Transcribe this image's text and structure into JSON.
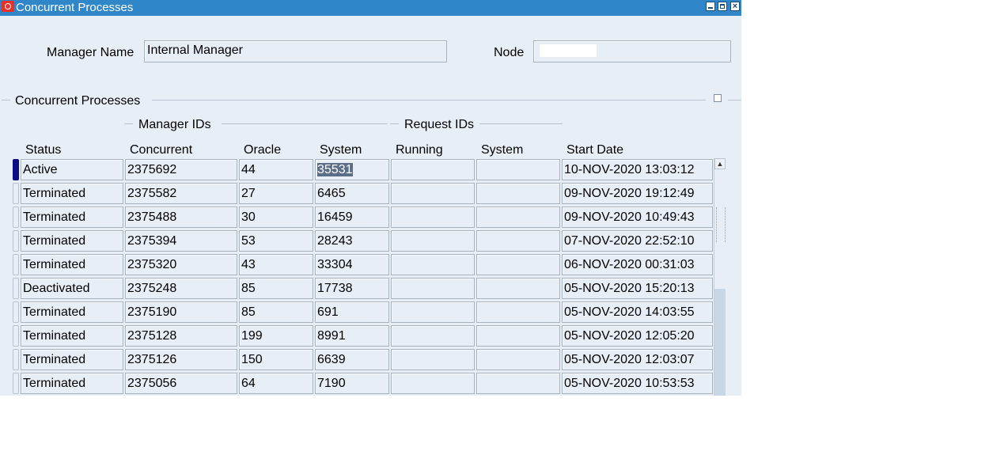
{
  "window": {
    "title": "Concurrent Processes"
  },
  "header": {
    "manager_name_label": "Manager Name",
    "manager_name_value": "Internal Manager",
    "node_label": "Node",
    "node_value": ""
  },
  "section": {
    "title": "Concurrent Processes",
    "group_manager_ids": "Manager  IDs",
    "group_request_ids": "Request IDs"
  },
  "columns": [
    "Status",
    "Concurrent",
    "Oracle",
    "System",
    "Running",
    "System",
    "Start Date"
  ],
  "rows": [
    {
      "status": "Active",
      "concurrent": "2375692",
      "oracle": "44",
      "system": "35531",
      "running": "",
      "req_system": "",
      "start_date": "10-NOV-2020 13:03:12"
    },
    {
      "status": "Terminated",
      "concurrent": "2375582",
      "oracle": "27",
      "system": "6465",
      "running": "",
      "req_system": "",
      "start_date": "09-NOV-2020 19:12:49"
    },
    {
      "status": "Terminated",
      "concurrent": "2375488",
      "oracle": "30",
      "system": "16459",
      "running": "",
      "req_system": "",
      "start_date": "09-NOV-2020 10:49:43"
    },
    {
      "status": "Terminated",
      "concurrent": "2375394",
      "oracle": "53",
      "system": "28243",
      "running": "",
      "req_system": "",
      "start_date": "07-NOV-2020 22:52:10"
    },
    {
      "status": "Terminated",
      "concurrent": "2375320",
      "oracle": "43",
      "system": "33304",
      "running": "",
      "req_system": "",
      "start_date": "06-NOV-2020 00:31:03"
    },
    {
      "status": "Deactivated",
      "concurrent": "2375248",
      "oracle": "85",
      "system": "17738",
      "running": "",
      "req_system": "",
      "start_date": "05-NOV-2020 15:20:13"
    },
    {
      "status": "Terminated",
      "concurrent": "2375190",
      "oracle": "85",
      "system": "691",
      "running": "",
      "req_system": "",
      "start_date": "05-NOV-2020 14:03:55"
    },
    {
      "status": "Terminated",
      "concurrent": "2375128",
      "oracle": "199",
      "system": "8991",
      "running": "",
      "req_system": "",
      "start_date": "05-NOV-2020 12:05:20"
    },
    {
      "status": "Terminated",
      "concurrent": "2375126",
      "oracle": "150",
      "system": "6639",
      "running": "",
      "req_system": "",
      "start_date": "05-NOV-2020 12:03:07"
    },
    {
      "status": "Terminated",
      "concurrent": "2375056",
      "oracle": "64",
      "system": "7190",
      "running": "",
      "req_system": "",
      "start_date": "05-NOV-2020 10:53:53"
    }
  ],
  "colors": {
    "titlebar": "#2f86c9",
    "window_bg": "#e8eef6",
    "row_current": "#0b0b85",
    "selection": "#5b6e89"
  },
  "icons": {
    "app": "oracle-app-icon",
    "scroll_up": "scroll-up-arrow-icon"
  }
}
